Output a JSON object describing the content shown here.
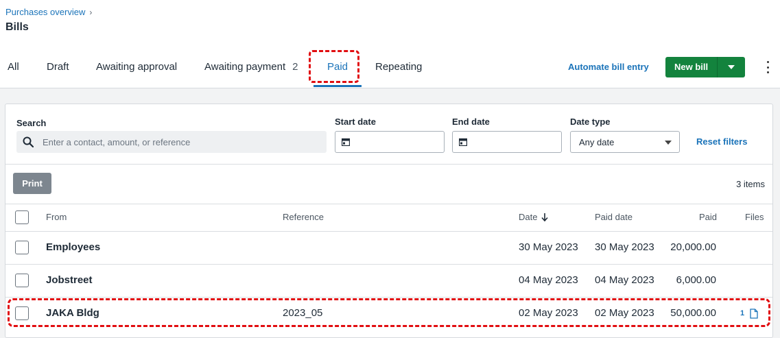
{
  "breadcrumb": {
    "parent": "Purchases overview",
    "chevron": "›"
  },
  "page": {
    "title": "Bills"
  },
  "tabs": [
    {
      "label": "All",
      "count": ""
    },
    {
      "label": "Draft",
      "count": ""
    },
    {
      "label": "Awaiting approval",
      "count": ""
    },
    {
      "label": "Awaiting payment",
      "count": "2"
    },
    {
      "label": "Paid",
      "count": "",
      "active": true
    },
    {
      "label": "Repeating",
      "count": ""
    }
  ],
  "toolbar": {
    "automate_label": "Automate bill entry",
    "new_bill_label": "New bill"
  },
  "filters": {
    "search_label": "Search",
    "search_placeholder": "Enter a contact, amount, or reference",
    "start_date_label": "Start date",
    "end_date_label": "End date",
    "date_type_label": "Date type",
    "date_type_value": "Any date",
    "reset_label": "Reset filters"
  },
  "actions": {
    "print_label": "Print",
    "items_count": "3 items"
  },
  "table": {
    "columns": {
      "from": "From",
      "reference": "Reference",
      "date": "Date",
      "paid_date": "Paid date",
      "paid": "Paid",
      "files": "Files"
    },
    "rows": [
      {
        "from": "Employees",
        "reference": "",
        "date": "30 May 2023",
        "paid_date": "30 May 2023",
        "paid": "20,000.00",
        "files": ""
      },
      {
        "from": "Jobstreet",
        "reference": "",
        "date": "04 May 2023",
        "paid_date": "04 May 2023",
        "paid": "6,000.00",
        "files": ""
      },
      {
        "from": "JAKA Bldg",
        "reference": "2023_05",
        "date": "02 May 2023",
        "paid_date": "02 May 2023",
        "paid": "50,000.00",
        "files": "1"
      }
    ]
  },
  "colors": {
    "accent": "#1a73b9",
    "primary_button": "#13833d",
    "highlight": "#e10d10"
  },
  "icons": [
    "search-icon",
    "calendar-icon",
    "chevron-down-icon",
    "sort-arrow-down-icon",
    "file-icon",
    "more-vertical-icon"
  ]
}
